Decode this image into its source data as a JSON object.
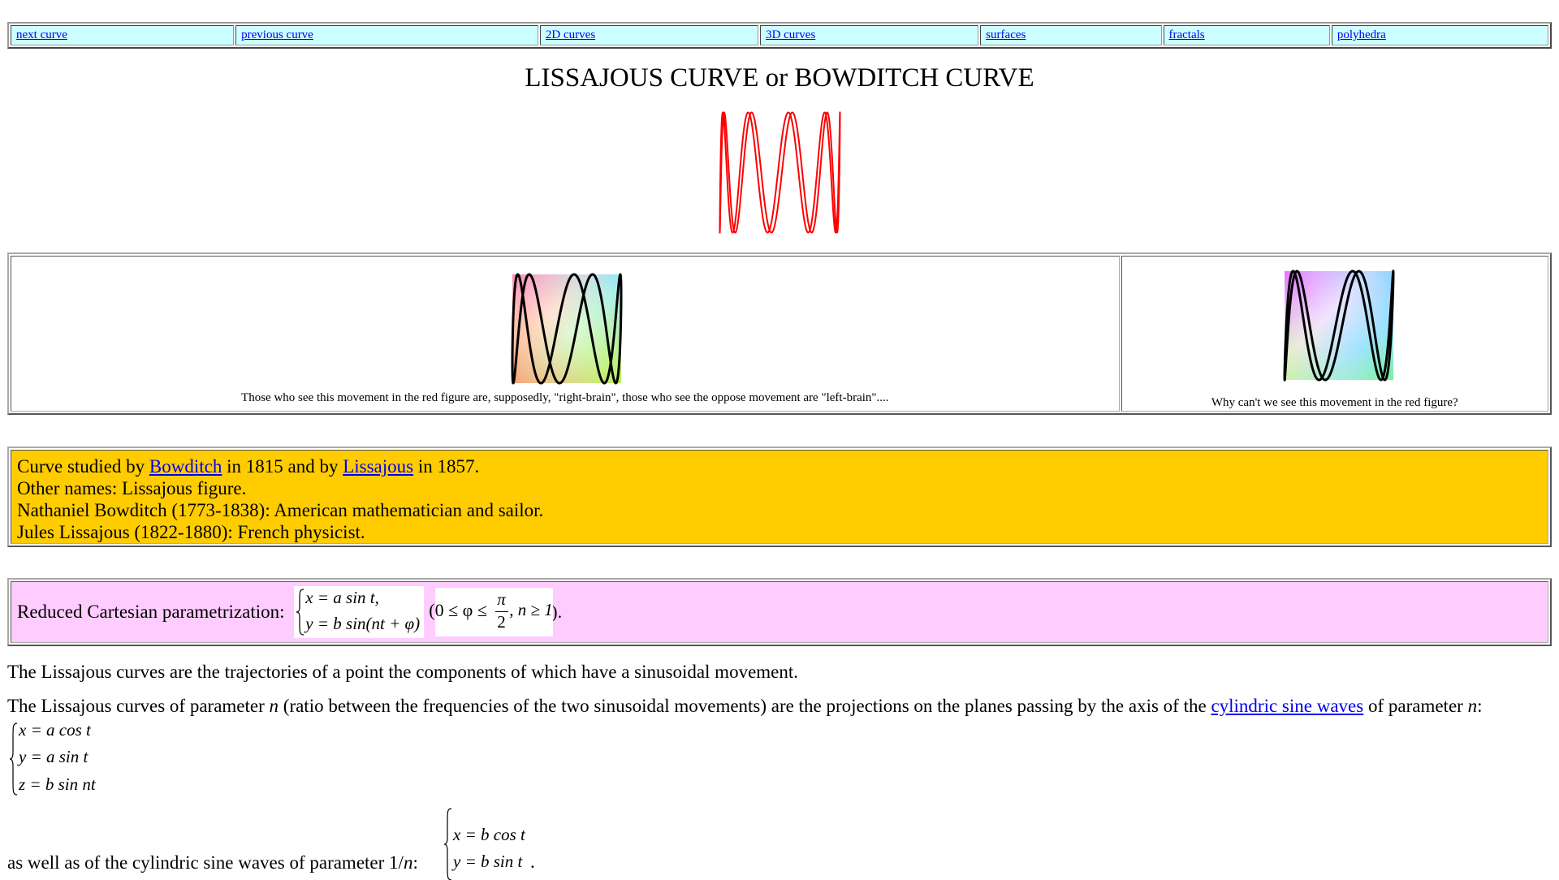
{
  "nav": {
    "items": [
      {
        "label": "next curve"
      },
      {
        "label": "previous curve"
      },
      {
        "label": "2D curves"
      },
      {
        "label": "3D curves"
      },
      {
        "label": "surfaces"
      },
      {
        "label": "fractals"
      },
      {
        "label": "polyhedra"
      }
    ]
  },
  "page_title": "LISSAJOUS CURVE or BOWDITCH CURVE",
  "figures": {
    "left_caption": "Those who see this movement in the red figure are, supposedly, \"right-brain\", those who see the oppose movement are \"left-brain\"....",
    "right_caption": "Why can't we see this movement in the red figure?"
  },
  "info": {
    "line1_prefix": "Curve studied by ",
    "line1_link1": "Bowditch",
    "line1_mid": " in 1815 and by ",
    "line1_link2": "Lissajous",
    "line1_suffix": " in 1857.",
    "line2": "Other names: Lissajous figure.",
    "line3": "Nathaniel Bowditch (1773-1838): American mathematician and sailor.",
    "line4": "Jules Lissajous (1822-1880): French physicist."
  },
  "param": {
    "label": "Reduced Cartesian parametrization: ",
    "eq1": "x = a sin t,",
    "eq2": "y = b sin(nt + φ)",
    "cond_prefix": "(0 ≤ φ ≤",
    "cond_pi": "π",
    "cond_two": "2",
    "cond_suffix": ", n ≥ 1",
    "cond_close": ").",
    "dot": ""
  },
  "para1": "The Lissajous curves are the trajectories of a point the components of which have a sinusoidal movement.",
  "para2": {
    "prefix": "The Lissajous curves of parameter ",
    "n1": "n",
    "mid": " (ratio between the frequencies of the two sinusoidal movements) are the projections on the planes passing by the axis of the ",
    "link": "cylindric sine waves",
    "suffix": " of parameter ",
    "n2": "n",
    "colon": ":"
  },
  "system1": {
    "eq1": "x = a cos t",
    "eq2": "y = a sin t",
    "eq3": "z = b sin nt"
  },
  "para3": {
    "text": "as well as of the cylindric sine waves of parameter 1/",
    "n": "n",
    "colon": ":",
    "end": "."
  },
  "system2": {
    "eq1": "x = b cos t",
    "eq2": "y = b sin t"
  },
  "colors": {
    "nav_bg": "#ccffff",
    "info_bg": "#ffcc00",
    "param_bg": "#ffccff",
    "curve_red": "#ff0000",
    "link": "#0000ee"
  }
}
